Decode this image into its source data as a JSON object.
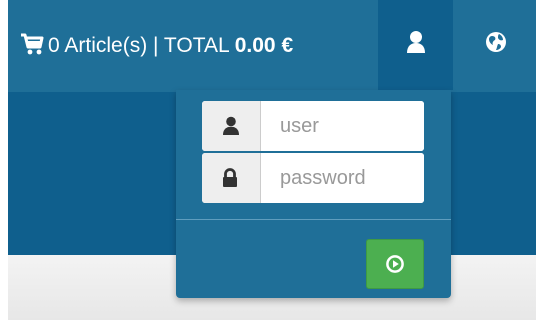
{
  "navbar": {
    "cart": {
      "count_text": "0 Article(s) | TOTAL ",
      "total": "0.00 €",
      "icon": "shopping-cart-icon"
    },
    "user_menu_icon": "user-icon",
    "language_menu_icon": "globe-icon"
  },
  "login_form": {
    "username": {
      "placeholder": "user",
      "value": "",
      "icon": "user-icon"
    },
    "password": {
      "placeholder": "password",
      "value": "",
      "icon": "lock-icon"
    },
    "submit_icon": "play-circle-icon"
  },
  "colors": {
    "navbar": "#1f6f98",
    "active_tab": "#0f5f8d",
    "submit": "#4caf50"
  }
}
